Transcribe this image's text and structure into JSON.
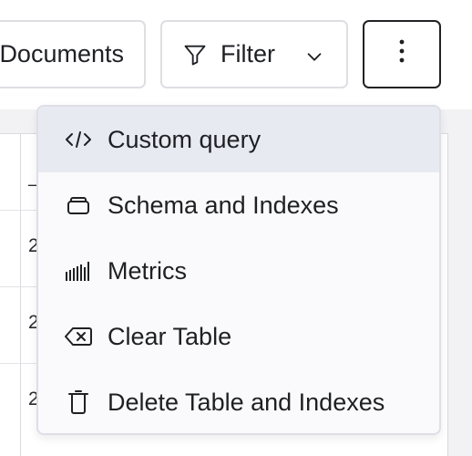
{
  "toolbar": {
    "documents_label": "Documents",
    "filter_label": "Filter",
    "filter_icon": "filter-icon",
    "chevron_icon": "chevron-down-icon",
    "more_icon": "vertical-ellipsis-icon"
  },
  "table": {
    "header_cell": "_",
    "cells": [
      "2",
      "2",
      "2"
    ]
  },
  "menu": {
    "items": [
      {
        "label": "Custom query",
        "icon": "code-icon"
      },
      {
        "label": "Schema and Indexes",
        "icon": "database-icon"
      },
      {
        "label": "Metrics",
        "icon": "bar-chart-icon"
      },
      {
        "label": "Clear Table",
        "icon": "backspace-icon"
      },
      {
        "label": "Delete Table and Indexes",
        "icon": "trash-icon"
      }
    ]
  },
  "colors": {
    "active_item_bg": "#e8eaf2",
    "menu_bg": "#fafafd",
    "border": "#dedee3"
  }
}
